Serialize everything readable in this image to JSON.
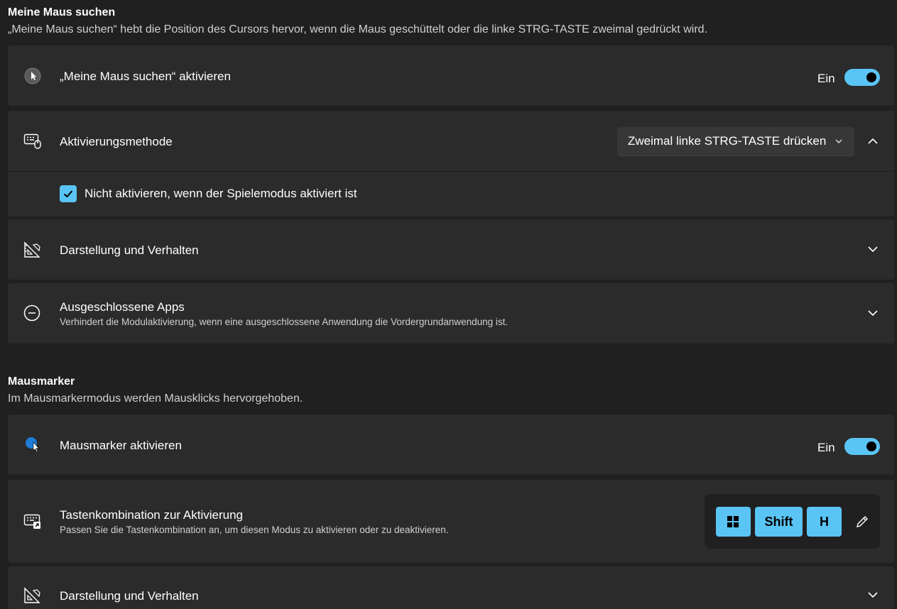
{
  "find_mouse": {
    "title": "Meine Maus suchen",
    "description": "„Meine Maus suchen“ hebt die Position des Cursors hervor, wenn die Maus geschüttelt oder die linke STRG-TASTE zweimal gedrückt wird.",
    "enable": {
      "label": "„Meine Maus suchen“ aktivieren",
      "state": "Ein",
      "on": true
    },
    "activation": {
      "label": "Aktivierungsmethode",
      "selected": "Zweimal linke STRG-TASTE drücken",
      "checkbox_label": "Nicht aktivieren, wenn der Spielemodus aktiviert ist",
      "checked": true
    },
    "appearance": {
      "label": "Darstellung und Verhalten"
    },
    "excluded": {
      "label": "Ausgeschlossene Apps",
      "description": "Verhindert die Modulaktivierung, wenn eine ausgeschlossene Anwendung die Vordergrundanwendung ist."
    }
  },
  "mouse_highlighter": {
    "title": "Mausmarker",
    "description": "Im Mausmarkermodus werden Mausklicks hervorgehoben.",
    "enable": {
      "label": "Mausmarker aktivieren",
      "state": "Ein",
      "on": true
    },
    "shortcut": {
      "label": "Tastenkombination zur Aktivierung",
      "description": "Passen Sie die Tastenkombination an, um diesen Modus zu aktivieren oder zu deaktivieren.",
      "keys": [
        "win",
        "Shift",
        "H"
      ]
    },
    "appearance": {
      "label": "Darstellung und Verhalten"
    }
  },
  "colors": {
    "accent": "#5ac4f5",
    "card": "#2b2b2b",
    "background": "#202020"
  }
}
